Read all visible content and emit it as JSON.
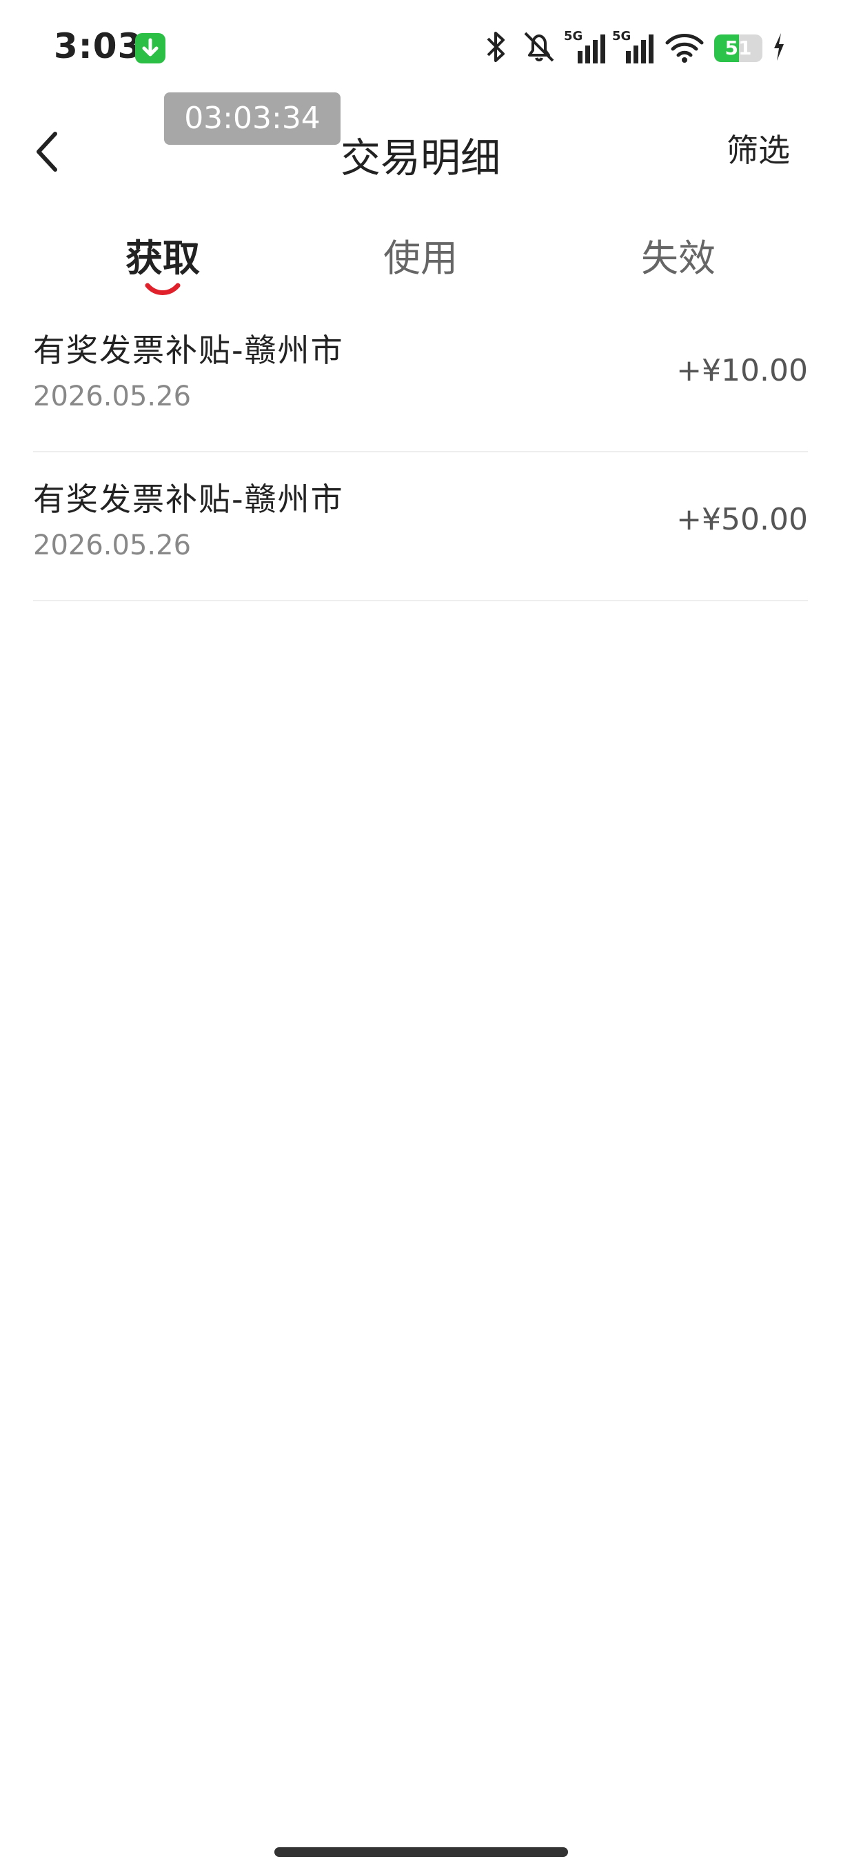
{
  "status_bar": {
    "time": "3:03",
    "battery_level": "51",
    "network_label_1": "5G",
    "network_label_2": "5G",
    "icons": [
      "download-icon",
      "bluetooth-icon",
      "mute-icon",
      "signal-icon",
      "signal-icon",
      "wifi-icon",
      "battery-icon",
      "charging-icon"
    ],
    "battery_fraction": 0.51
  },
  "timer": {
    "text": "03:03:34"
  },
  "nav": {
    "title": "交易明细",
    "filter_label": "筛选",
    "back_icon": "chevron-left-icon"
  },
  "tabs": [
    {
      "label": "获取",
      "active": true
    },
    {
      "label": "使用",
      "active": false
    },
    {
      "label": "失效",
      "active": false
    }
  ],
  "colors": {
    "accent": "#e0202a",
    "positive_green": "#2cc34a",
    "divider": "#eeeeee"
  },
  "transactions": [
    {
      "title": "有奖发票补贴-赣州市",
      "date": "2026.05.26",
      "amount": "+¥10.00"
    },
    {
      "title": "有奖发票补贴-赣州市",
      "date": "2026.05.26",
      "amount": "+¥50.00"
    }
  ]
}
